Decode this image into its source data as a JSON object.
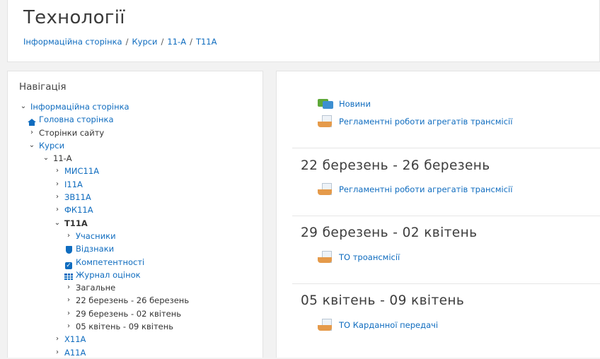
{
  "header": {
    "title": "Технології",
    "breadcrumb": [
      "Інформаційна сторінка",
      "Курси",
      "11-А",
      "Т11А"
    ]
  },
  "navigation": {
    "heading": "Навігація",
    "items": [
      {
        "label": "Інформаційна сторінка",
        "expander": "v",
        "link": true
      },
      {
        "label": "Головна сторінка",
        "icon": "home-icon",
        "link": true
      },
      {
        "label": "Сторінки сайту",
        "expander": ">",
        "link": false
      },
      {
        "label": "Курси",
        "expander": "v",
        "link": true
      },
      {
        "label": "11-А",
        "expander": "v",
        "link": false
      },
      {
        "label": "МИС11А",
        "expander": ">",
        "link": true
      },
      {
        "label": "І11А",
        "expander": ">",
        "link": true
      },
      {
        "label": "ЗВ11А",
        "expander": ">",
        "link": true
      },
      {
        "label": "ФК11А",
        "expander": ">",
        "link": true
      },
      {
        "label": "Т11А",
        "expander": "v",
        "link": false,
        "bold": true
      },
      {
        "label": "Учасники",
        "expander": ">",
        "link": true
      },
      {
        "label": "Відзнаки",
        "icon": "badge-shield-icon",
        "link": true
      },
      {
        "label": "Компетентності",
        "icon": "checkbox-icon",
        "link": true
      },
      {
        "label": "Журнал оцінок",
        "icon": "gradebook-table-icon",
        "link": true
      },
      {
        "label": "Загальне",
        "expander": ">",
        "link": false
      },
      {
        "label": "22 березень - 26 березень",
        "expander": ">",
        "link": false
      },
      {
        "label": "29 березень - 02 квітень",
        "expander": ">",
        "link": false
      },
      {
        "label": "05 квітень - 09 квітень",
        "expander": ">",
        "link": false
      },
      {
        "label": "Х11А",
        "expander": ">",
        "link": true
      },
      {
        "label": "А11А",
        "expander": ">",
        "link": true
      }
    ]
  },
  "main": {
    "top_activities": [
      {
        "label": "Новини",
        "icon": "forum-icon"
      },
      {
        "label": "Регламентні роботи агрегатів трансмісії",
        "icon": "file-icon"
      }
    ],
    "sections": [
      {
        "title": "22 березень - 26 березень",
        "activity": "Регламентні роботи агрегатів трансмісії"
      },
      {
        "title": "29 березень - 02 квітень",
        "activity": "ТО троансмісії"
      },
      {
        "title": "05 квітень - 09 квітень",
        "activity": "ТО Карданної передачі"
      }
    ]
  },
  "colors": {
    "link": "#0f6cbf",
    "title": "#3a3a3a",
    "forum_green": "#5ea838",
    "forum_blue": "#3d8fd1",
    "file_orange": "#e59a4a"
  }
}
